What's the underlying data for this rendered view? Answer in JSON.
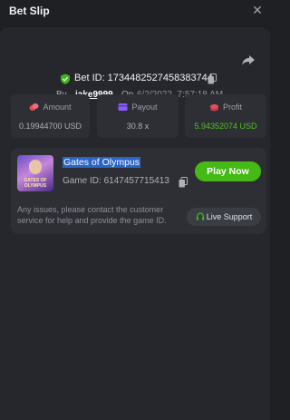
{
  "header": {
    "title": "Bet Slip",
    "close_icon": "close-icon"
  },
  "bet": {
    "id_text": "Bet ID: 1734482527458383744",
    "by_label": "By",
    "username": "jake9999",
    "on_label": "On",
    "date": "6/2/2022, 7:57:18 AM"
  },
  "stats": [
    {
      "label": "Amount",
      "value": "0.19944700 USD",
      "icon": "coins-icon",
      "color": "#e84a5f"
    },
    {
      "label": "Payout",
      "value": "30.8 x",
      "icon": "card-icon",
      "color": "#8a5cf6"
    },
    {
      "label": "Profit",
      "value": "5.94352074 USD",
      "icon": "coins-icon",
      "color": "#e84a5f"
    }
  ],
  "game": {
    "name": "Gates of Olympus",
    "id_text": "Game ID: 6147457715413",
    "thumb_text": "GATES OF OLYMPUS",
    "play_label": "Play Now",
    "notice": "Any issues, please contact the customer service for help and provide the game ID.",
    "support_label": "Live Support"
  },
  "colors": {
    "accent_green": "#45b915",
    "profit_green": "#4fc21c",
    "background": "#1e2024",
    "panel": "#25272c"
  }
}
